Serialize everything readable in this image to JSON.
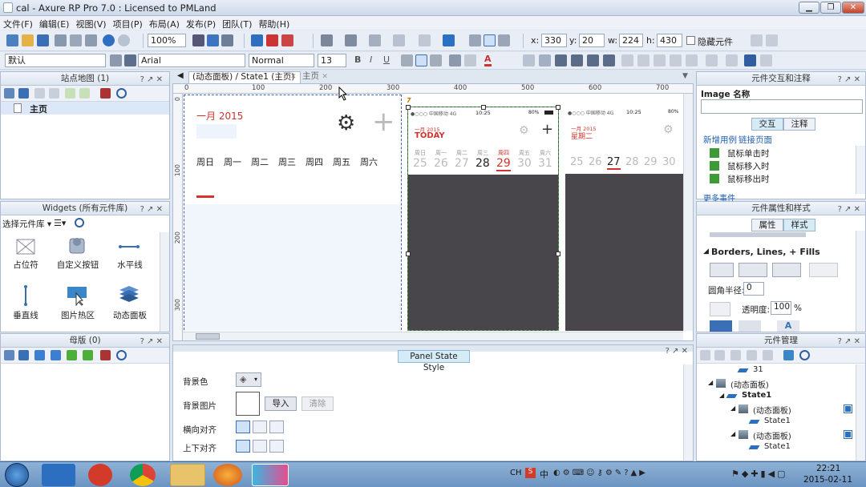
{
  "window": {
    "title": "cal - Axure RP Pro 7.0 : Licensed to PMLand"
  },
  "menu": [
    "文件(F)",
    "编辑(E)",
    "视图(V)",
    "项目(P)",
    "布局(A)",
    "发布(P)",
    "团队(T)",
    "帮助(H)"
  ],
  "toolbar": {
    "zoom": "100%",
    "x_label": "x:",
    "x": "330",
    "y_label": "y:",
    "y": "20",
    "w_label": "w:",
    "w": "224",
    "h_label": "h:",
    "h": "430",
    "hide_label": "隐藏元件",
    "style_default": "默认",
    "font": "Arial",
    "font_style": "Normal",
    "font_size": "13"
  },
  "sitemap": {
    "title": "站点地图 (1)",
    "items": [
      "主页"
    ]
  },
  "widgets": {
    "title": "Widgets (所有元件库)",
    "library_label": "选择元件库",
    "items": [
      "占位符",
      "自定义按钮",
      "水平线",
      "垂直线",
      "图片热区",
      "动态面板"
    ]
  },
  "masters": {
    "title": "母版 (0)"
  },
  "tabs": [
    {
      "label": "(动态面板) / State1 (主页)",
      "active": true
    },
    {
      "label": "主页",
      "active": false
    }
  ],
  "ruler": {
    "top": [
      "0",
      "100",
      "200",
      "300",
      "400",
      "500",
      "600",
      "700"
    ],
    "left": [
      "0",
      "100",
      "200",
      "300"
    ]
  },
  "canvas": {
    "month": "一月 2015",
    "weekdays": [
      "周日",
      "周一",
      "周二",
      "周三",
      "周四",
      "周五",
      "周六"
    ],
    "marker_label": "7",
    "accent": "#d0342c",
    "phone1": {
      "carrier": "●○○○ 中国移动 4G",
      "time": "10:25",
      "battery": "80%",
      "month": "一月 2015",
      "headline": "TODAY",
      "day_labels": [
        "周日",
        "周一",
        "周二",
        "周三",
        "周四",
        "周五",
        "周六"
      ],
      "days": [
        "25",
        "26",
        "27",
        "28",
        "29",
        "30",
        "31"
      ]
    },
    "phone2": {
      "carrier": "●○○○ 中国移动 4G",
      "time": "10:25",
      "battery": "80%",
      "month": "一月 2015",
      "headline": "星期二",
      "days": [
        "25",
        "26",
        "27",
        "28",
        "29",
        "30"
      ]
    }
  },
  "interactions": {
    "title": "元件交互和注释",
    "name_label": "Image 名称",
    "tab_interaction": "交互",
    "tab_notes": "注释",
    "link_new_case": "新增用例",
    "link_page": "链接页面",
    "events": [
      "鼠标单击时",
      "鼠标移入时",
      "鼠标移出时"
    ],
    "more_events": "更多事件"
  },
  "properties": {
    "title": "元件属性和样式",
    "tab_properties": "属性",
    "tab_style": "样式",
    "section": "Borders, Lines, + Fills",
    "radius_label": "圆角半径:",
    "radius": "0",
    "opacity_label": "透明度:",
    "opacity": "100",
    "opacity_unit": "%"
  },
  "state_style": {
    "title": "Panel State Style",
    "bg_color_label": "背景色",
    "bg_image_label": "背景图片",
    "import_button": "导入",
    "clear_button": "清除",
    "h_align_label": "横向对齐",
    "v_align_label": "上下对齐"
  },
  "manager": {
    "title": "元件管理",
    "nodes": [
      {
        "indent": 3,
        "label": "31",
        "icon": "state"
      },
      {
        "indent": 1,
        "label": "(动态面板)",
        "icon": "panel"
      },
      {
        "indent": 2,
        "label": "State1",
        "icon": "state",
        "bold": true
      },
      {
        "indent": 3,
        "label": "(动态面板)",
        "icon": "panel"
      },
      {
        "indent": 4,
        "label": "State1",
        "icon": "state"
      },
      {
        "indent": 3,
        "label": "(动态面板)",
        "icon": "panel"
      },
      {
        "indent": 4,
        "label": "State1",
        "icon": "state"
      }
    ]
  },
  "taskbar": {
    "time": "22:21",
    "date": "2015-02-11",
    "tray": [
      "CH",
      "S",
      "中"
    ]
  }
}
